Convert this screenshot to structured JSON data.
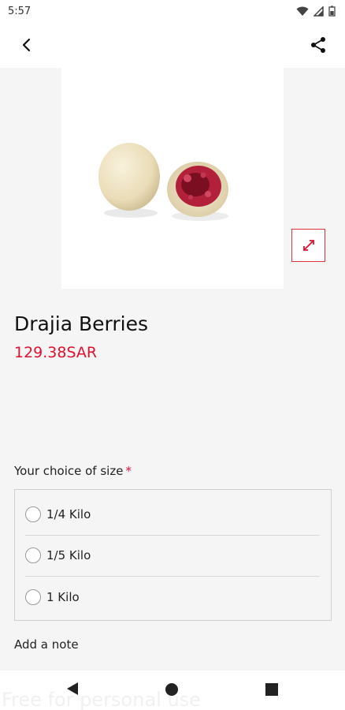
{
  "status_bar": {
    "time": "5:57"
  },
  "product": {
    "name": "Drajia Berries",
    "price": "129.38SAR"
  },
  "size_section": {
    "title": "Your choice of size",
    "required_marker": "*",
    "options": [
      {
        "label": "1/4 Kilo"
      },
      {
        "label": "1/5 Kilo"
      },
      {
        "label": "1 Kilo"
      }
    ]
  },
  "note": {
    "label": "Add a note"
  },
  "watermark": "Free for personal use",
  "icons": {
    "back": "back-arrow-icon",
    "share": "share-icon",
    "expand": "expand-icon",
    "nav_back": "triangle-back-icon",
    "nav_home": "circle-home-icon",
    "nav_recent": "square-recent-icon"
  },
  "colors": {
    "accent": "#e0102f",
    "expand_border": "#e0323b"
  }
}
